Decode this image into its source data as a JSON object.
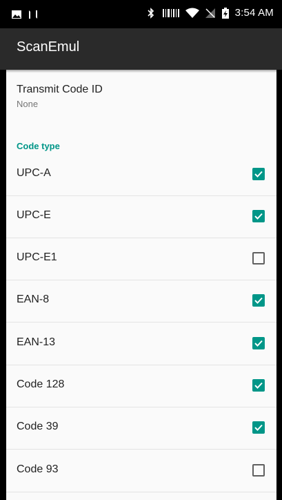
{
  "status_bar": {
    "time": "3:54 AM",
    "icons": [
      "gallery-icon",
      "nfc-icon",
      "bluetooth-icon",
      "barcode-icon",
      "wifi-icon",
      "no-sim-icon",
      "battery-charging-icon"
    ]
  },
  "app_bar": {
    "title": "ScanEmul"
  },
  "transmit": {
    "title": "Transmit Code ID",
    "summary": "None"
  },
  "code_type": {
    "category_label": "Code type",
    "items": [
      {
        "label": "UPC-A",
        "checked": true
      },
      {
        "label": "UPC-E",
        "checked": true
      },
      {
        "label": "UPC-E1",
        "checked": false
      },
      {
        "label": "EAN-8",
        "checked": true
      },
      {
        "label": "EAN-13",
        "checked": true
      },
      {
        "label": "Code 128",
        "checked": true
      },
      {
        "label": "Code 39",
        "checked": true
      },
      {
        "label": "Code 93",
        "checked": false
      }
    ]
  },
  "colors": {
    "accent": "#009688",
    "appbar": "#2a2a2a",
    "background": "#fafafa"
  }
}
